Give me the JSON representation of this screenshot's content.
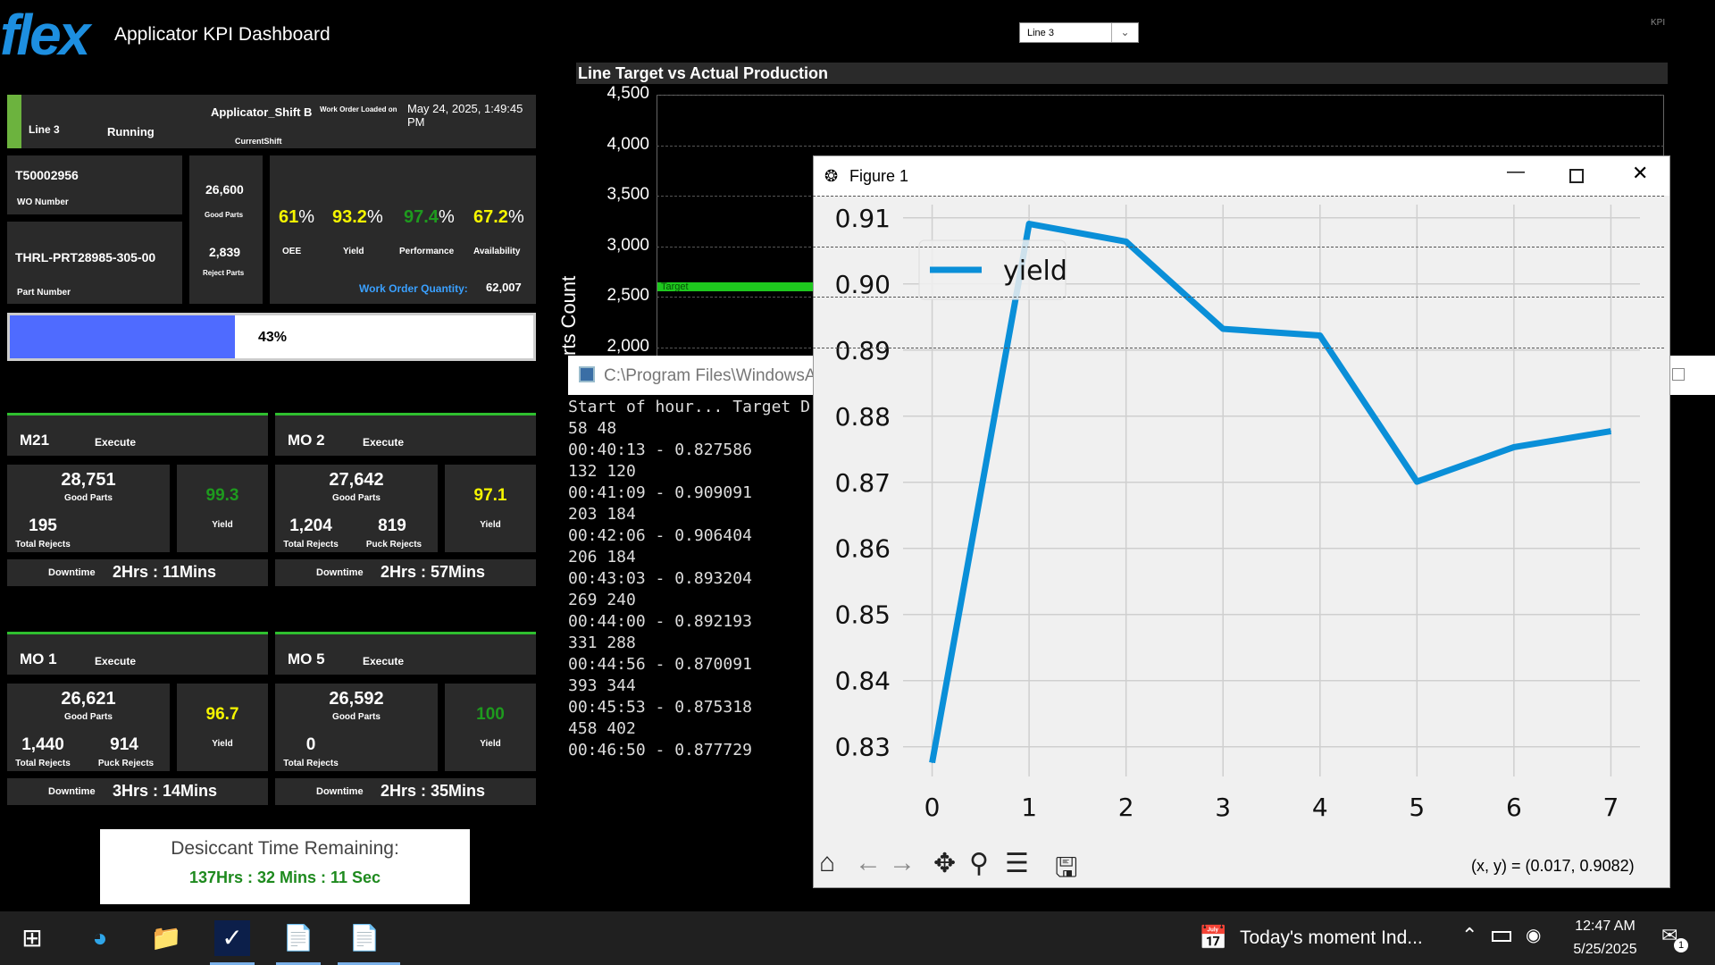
{
  "header": {
    "logo": "flex",
    "title": "Applicator KPI  Dashboard",
    "line_select": "Line 3",
    "corner": "KPI"
  },
  "line_panel": {
    "line": "Line  3",
    "status": "Running",
    "shift": "Applicator_Shift B",
    "current_shift_label": "CurrentShift",
    "wo_loaded_label": "Work Order Loaded on",
    "wo_loaded_time": "May 24, 2025, 1:49:45 PM"
  },
  "work_order": {
    "wo_number": "T50002956",
    "wo_number_label": "WO Number",
    "part_number": "THRL-PRT28985-305-00",
    "part_number_label": "Part Number",
    "good_parts": "26,600",
    "good_parts_label": "Good Parts",
    "reject_parts": "2,839",
    "reject_parts_label": "Reject Parts",
    "oee": "61",
    "oee_label": "OEE",
    "yield": "93.2",
    "yield_label": "Yield",
    "performance": "97.4",
    "performance_label": "Performance",
    "availability": "67.2",
    "availability_label": "Availability",
    "pct": "%",
    "qty_label": "Work Order Quantity:",
    "qty": "62,007",
    "progress_text": "43%",
    "progress": 0.43
  },
  "machines": [
    {
      "name": "M21",
      "state": "Execute",
      "good": "28,751",
      "good_label": "Good Parts",
      "total_rejects": "195",
      "total_rejects_label": "Total Rejects",
      "puck_rejects": "",
      "puck_rejects_label": "",
      "yield": "99.3",
      "yield_label": "Yield",
      "yield_color": "#1e9a1e",
      "downtime_label": "Downtime",
      "downtime": "2Hrs : 11Mins"
    },
    {
      "name": "MO 2",
      "state": "Execute",
      "good": "27,642",
      "good_label": "Good Parts",
      "total_rejects": "1,204",
      "total_rejects_label": "Total Rejects",
      "puck_rejects": "819",
      "puck_rejects_label": "Puck Rejects",
      "yield": "97.1",
      "yield_label": "Yield",
      "yield_color": "#f5f500",
      "downtime_label": "Downtime",
      "downtime": "2Hrs : 57Mins"
    },
    {
      "name": "MO 1",
      "state": "Execute",
      "good": "26,621",
      "good_label": "Good Parts",
      "total_rejects": "1,440",
      "total_rejects_label": "Total Rejects",
      "puck_rejects": "914",
      "puck_rejects_label": "Puck Rejects",
      "yield": "96.7",
      "yield_label": "Yield",
      "yield_color": "#f5f500",
      "downtime_label": "Downtime",
      "downtime": "3Hrs : 14Mins"
    },
    {
      "name": "MO 5",
      "state": "Execute",
      "good": "26,592",
      "good_label": "Good Parts",
      "total_rejects": "0",
      "total_rejects_label": "Total Rejects",
      "puck_rejects": "",
      "puck_rejects_label": "",
      "yield": "100",
      "yield_label": "Yield",
      "yield_color": "#1e9a1e",
      "downtime_label": "Downtime",
      "downtime": "2Hrs : 35Mins"
    }
  ],
  "desiccant": {
    "label": "Desiccant Time Remaining:",
    "time": "137Hrs : 32 Mins : 11 Sec"
  },
  "bg_chart": {
    "title": "Line Target vs  Actual Production",
    "ylabel": "rts Count",
    "target_label": "Target",
    "ticks": [
      "4,500",
      "4,000",
      "3,500",
      "3,000",
      "2,500",
      "2,000"
    ]
  },
  "console": {
    "title": "C:\\Program Files\\WindowsAp",
    "lines": [
      "Start of hour... Target D",
      "58 48",
      "00:40:13 - 0.827586",
      "132 120",
      "00:41:09 - 0.909091",
      "203 184",
      "00:42:06 - 0.906404",
      "206 184",
      "00:43:03 - 0.893204",
      "269 240",
      "00:44:00 - 0.892193",
      "331 288",
      "00:44:56 - 0.870091",
      "393 344",
      "00:45:53 - 0.875318",
      "458 402",
      "00:46:50 - 0.877729"
    ]
  },
  "figure": {
    "title": "Figure 1",
    "coord_readout": "(x, y) = (0.017, 0.9082)"
  },
  "chart_data": {
    "type": "line",
    "x": [
      0,
      1,
      2,
      3,
      4,
      5,
      6,
      7
    ],
    "series": [
      {
        "name": "yield",
        "values": [
          0.827586,
          0.909091,
          0.906404,
          0.893204,
          0.892193,
          0.870091,
          0.875318,
          0.877729
        ],
        "color": "#0a8fd8"
      }
    ],
    "xticks": [
      "0",
      "1",
      "2",
      "3",
      "4",
      "5",
      "6",
      "7"
    ],
    "yticks": [
      "0.83",
      "0.84",
      "0.85",
      "0.86",
      "0.87",
      "0.88",
      "0.89",
      "0.90",
      "0.91"
    ],
    "xlim": [
      -0.3,
      7.3
    ],
    "ylim": [
      0.8255,
      0.912
    ],
    "grid": true,
    "legend": "upper-left"
  },
  "taskbar": {
    "notification": "Today's moment  Ind...",
    "time": "12:47 AM",
    "date": "5/25/2025",
    "badge": "1"
  }
}
